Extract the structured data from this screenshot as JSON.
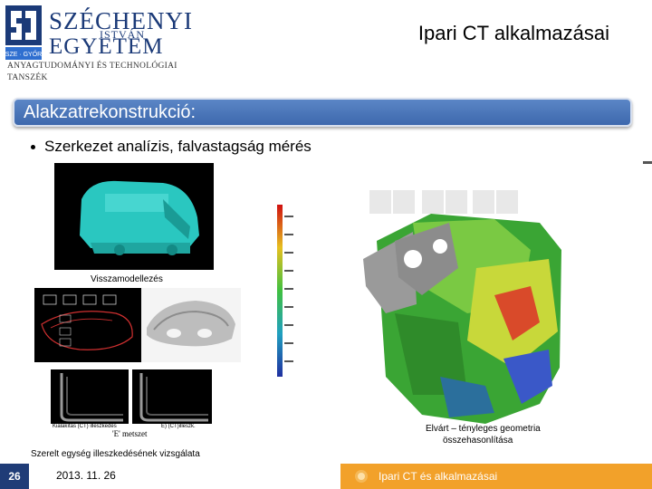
{
  "logo": {
    "name_line1": "SZÉCHENYI",
    "name_line2": "ISTVÁN",
    "name_line3": "EGYETEM",
    "dept_line1": "ANYAGTUDOMÁNYI ÉS TECHNOLÓGIAI",
    "dept_line2": "TANSZÉK",
    "mark_text": "SZE · GYŐR"
  },
  "slide_title": "Ipari CT alkalmazásai",
  "section_title": "Alakzatrekonstrukció:",
  "bullet": "Szerkezet analízis, falvastagság mérés",
  "captions": {
    "reverse_engineering": "Visszamodellezés",
    "assembly_fit": "Szerelt egység illeszkedésének vizsgálata",
    "comparison_line1": "Elvárt – tényleges geometria",
    "comparison_line2": "összehasonlítása",
    "section_label": "'E' metszet",
    "section_left_tag": "Kialakítás (CT) illeszkedés",
    "section_right_tag": "E) (CT)illeszk."
  },
  "footer": {
    "page_number": "26",
    "date": "2013. 11. 26",
    "subject": "Ipari CT és alkalmazásai"
  },
  "colors": {
    "brand_blue": "#1b3a78",
    "section_bar": "#4a76ba",
    "footer_orange": "#f2a12a",
    "footer_navy": "#1f3c77"
  }
}
